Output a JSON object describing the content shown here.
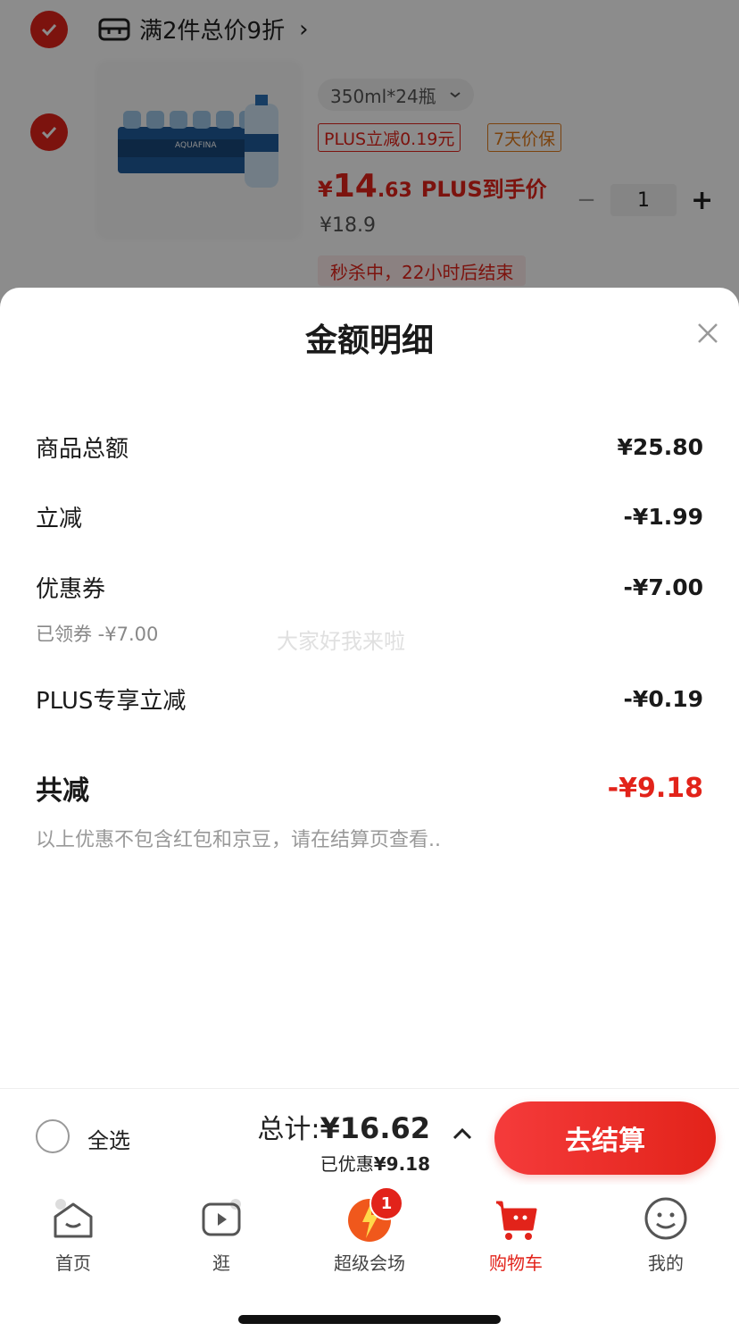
{
  "cart": {
    "promo_text": "满2件总价9折",
    "promo_chevron": "›",
    "spec": "350ml*24瓶",
    "tag_plus": "PLUS立减0.19元",
    "tag_guarantee": "7天价保",
    "price_yen": "¥",
    "price_int": "14",
    "price_dec": ".63",
    "price_label": "PLUS到手价",
    "orig_price": "¥18.9",
    "qty_minus": "−",
    "qty": "1",
    "qty_plus": "+",
    "flash": "秒杀中，22小时后结束",
    "brand_text": "AQUAFINA"
  },
  "sheet": {
    "title": "金额明细",
    "rows": [
      {
        "label": "商品总额",
        "value": "¥25.80"
      },
      {
        "label": "立减",
        "value": "-¥1.99"
      },
      {
        "label": "优惠券",
        "value": "-¥7.00"
      },
      {
        "label": "PLUS专享立减",
        "value": "-¥0.19"
      }
    ],
    "coupon_sub": "已领券 -¥7.00",
    "total_label": "共减",
    "total_value": "-¥9.18",
    "note": "以上优惠不包含红包和京豆，请在结算页查看..",
    "watermark": "大家好我来啦"
  },
  "checkout": {
    "select_all": "全选",
    "total_prefix": "总计:",
    "total_amount": "¥16.62",
    "saved_prefix": "已优惠",
    "saved_amount": "¥9.18",
    "button": "去结算"
  },
  "tabs": [
    {
      "label": "首页",
      "icon": "home-icon"
    },
    {
      "label": "逛",
      "icon": "play-icon"
    },
    {
      "label": "超级会场",
      "icon": "super-venue-icon",
      "badge": "1"
    },
    {
      "label": "购物车",
      "icon": "cart-icon"
    },
    {
      "label": "我的",
      "icon": "profile-icon"
    }
  ],
  "colors": {
    "accent": "#e2231a",
    "guarantee": "#e07a1b"
  }
}
